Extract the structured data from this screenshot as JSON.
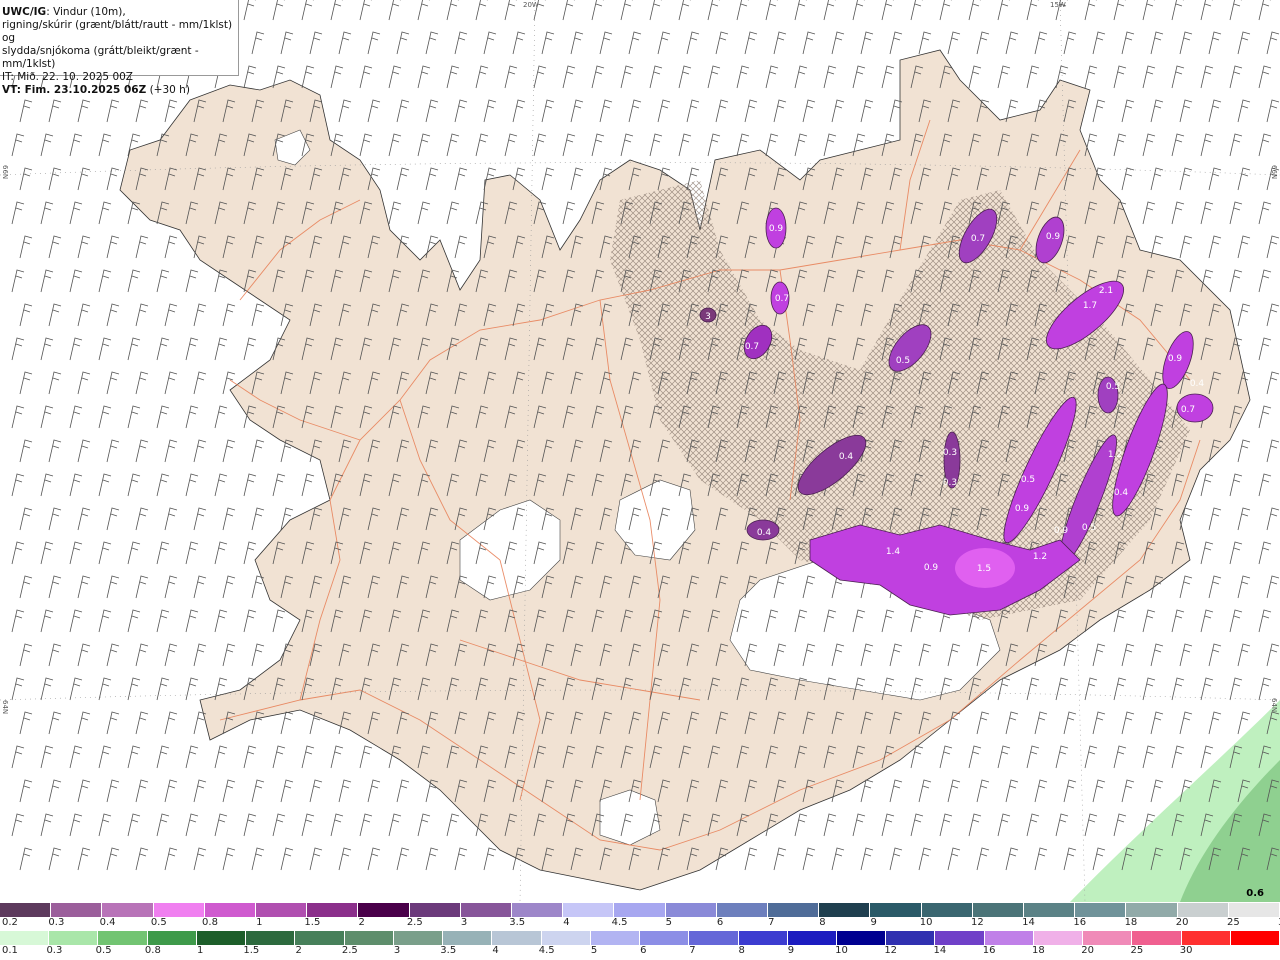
{
  "info": {
    "title_bold": "UWC/IG",
    "title_rest": ": Vindur (10m),",
    "line2": "rigning/skúrir (grænt/blátt/rautt - mm/1klst) og",
    "line3": "slydda/snjókoma (grátt/bleikt/grænt - mm/1klst)",
    "it": "IT: Mið. 22. 10. 2025 00Z",
    "vt_bold": "VT: Fim. 23.10.2025 06Z",
    "vt_rest": " (+30 h)"
  },
  "grid_labels": {
    "top_left": "20W",
    "top_right": "15W",
    "left_upper": "66N",
    "left_lower": "64N",
    "right_upper": "66N",
    "right_lower": "64N"
  },
  "corner_value": "0.6",
  "colors": {
    "land": "#f1e2d3",
    "glacier": "#ffffff",
    "roads": "#e8825a",
    "precip": "#c640e0"
  },
  "precip_labels": [
    "0.9",
    "0.7",
    "0.9",
    "2.1",
    "1.7",
    "0.7",
    "0.7",
    "0.5",
    "3",
    "0.9",
    "0.5",
    "0.4",
    "0.7",
    "0.4",
    "1.2",
    "0.4",
    "0.3",
    "0.3",
    "0.5",
    "0.9",
    "0.9",
    "0.5",
    "0.4",
    "1.4",
    "0.9",
    "1.5",
    "1.2"
  ],
  "legend_top": {
    "colors": [
      "#5d3a5d",
      "#9b5e9b",
      "#b873b8",
      "#f07ff0",
      "#cf5acf",
      "#b04fb0",
      "#8b2f8b",
      "#4a004a",
      "#6b3a7b",
      "#87559a",
      "#9d86c9",
      "#c6c6f7",
      "#a7a7f0",
      "#8a8ad8",
      "#6d7fbd",
      "#4f6c98",
      "#1f3f4f",
      "#2a5a68",
      "#3a6670",
      "#4b7478",
      "#5b8286",
      "#70939a",
      "#91aaa9",
      "#c9cfd0",
      "#e6e6e6"
    ],
    "labels": [
      "0.2",
      "0.3",
      "0.4",
      "0.5",
      "0.8",
      "1",
      "1.5",
      "2",
      "2.5",
      "3",
      "3.5",
      "4",
      "4.5",
      "5",
      "6",
      "7",
      "8",
      "9",
      "10",
      "12",
      "14",
      "16",
      "18",
      "20",
      "25",
      "30"
    ]
  },
  "legend_bottom": {
    "colors": [
      "#d7f8d7",
      "#a9e6a9",
      "#72c472",
      "#3e9a4a",
      "#1d5e2a",
      "#2d6a3e",
      "#47805a",
      "#5e8e6c",
      "#7a9f8a",
      "#97b2b7",
      "#b8c6d6",
      "#cdd4ef",
      "#b2b4f2",
      "#8c8ee6",
      "#6567d8",
      "#3c3cd0",
      "#1c1cc0",
      "#000090",
      "#3030b0",
      "#7040c8",
      "#c080e8",
      "#f0b0e8",
      "#f08ab8",
      "#f06090",
      "#ff3030",
      "#ff0000"
    ],
    "labels": [
      "0.1",
      "0.3",
      "0.5",
      "0.8",
      "1",
      "1.5",
      "2",
      "2.5",
      "3",
      "3.5",
      "4",
      "4.5",
      "5",
      "6",
      "7",
      "8",
      "9",
      "10",
      "12",
      "14",
      "16",
      "18",
      "20",
      "25",
      "30"
    ]
  }
}
